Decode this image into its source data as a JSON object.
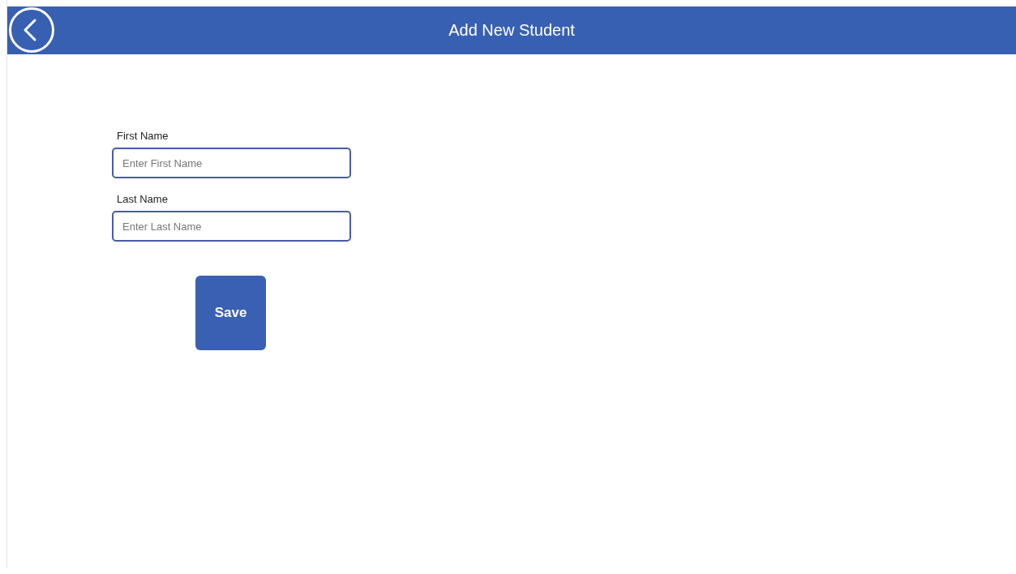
{
  "header": {
    "title": "Add New Student"
  },
  "fields": [
    {
      "label": "First Name",
      "placeholder": "Enter First Name"
    },
    {
      "label": "Last Name",
      "placeholder": "Enter Last Name"
    }
  ],
  "save_button": {
    "label": "Save"
  }
}
